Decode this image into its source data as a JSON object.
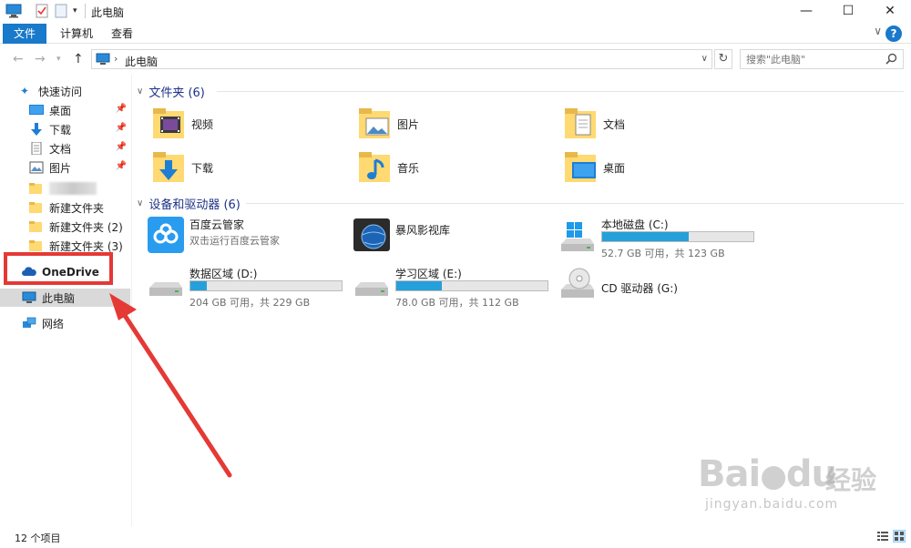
{
  "window": {
    "title": "此电脑",
    "minimize": "—",
    "maximize": "☐",
    "close": "✕"
  },
  "ribbon": {
    "tabs": [
      "文件",
      "计算机",
      "查看"
    ],
    "collapse": "∨",
    "help": "?"
  },
  "address": {
    "path": "此电脑",
    "search_placeholder": "搜索\"此电脑\""
  },
  "nav": {
    "quick_access": "快速访问",
    "items": [
      {
        "label": "桌面",
        "pinned": true,
        "icon": "desktop-icon"
      },
      {
        "label": "下载",
        "pinned": true,
        "icon": "download-icon"
      },
      {
        "label": "文档",
        "pinned": true,
        "icon": "document-icon"
      },
      {
        "label": "图片",
        "pinned": true,
        "icon": "picture-icon"
      }
    ],
    "folders": [
      "新建文件夹",
      "新建文件夹 (2)",
      "新建文件夹 (3)"
    ],
    "onedrive": "OneDrive",
    "this_pc": "此电脑",
    "network": "网络"
  },
  "folders_group": {
    "header": "文件夹 (6)",
    "items": [
      "视频",
      "图片",
      "文档",
      "下载",
      "音乐",
      "桌面"
    ]
  },
  "devices_group": {
    "header": "设备和驱动器 (6)",
    "baidu": {
      "name": "百度云管家",
      "sub": "双击运行百度云管家"
    },
    "storm": {
      "name": "暴风影视库"
    },
    "drives": [
      {
        "name": "本地磁盘 (C:)",
        "free": "52.7 GB 可用，共 123 GB",
        "used_fraction": 0.57
      },
      {
        "name": "数据区域 (D:)",
        "free": "204 GB 可用，共 229 GB",
        "used_fraction": 0.11
      },
      {
        "name": "学习区域 (E:)",
        "free": "78.0 GB 可用，共 112 GB",
        "used_fraction": 0.3
      }
    ],
    "cd": {
      "name": "CD 驱动器 (G:)"
    }
  },
  "status": {
    "count": "12 个项目"
  },
  "watermark": {
    "brand": "Bai",
    "brand2": "du",
    "cn": "经验",
    "url": "jingyan.baidu.com"
  },
  "colors": {
    "accent": "#1979ca",
    "drive_bar": "#26a0da",
    "annotation": "#e53935"
  }
}
